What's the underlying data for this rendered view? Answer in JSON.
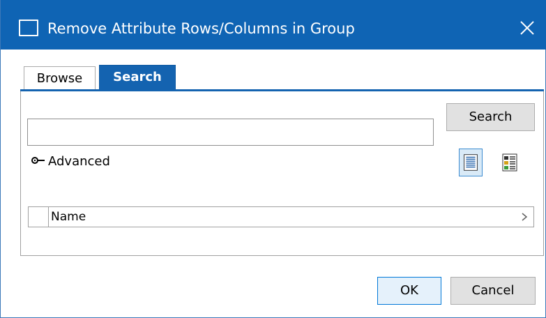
{
  "window": {
    "title": "Remove Attribute Rows/Columns in Group",
    "close_icon": "close-icon"
  },
  "tabs": [
    {
      "label": "Browse",
      "active": false
    },
    {
      "label": "Search",
      "active": true
    }
  ],
  "search": {
    "value": "",
    "button_label": "Search"
  },
  "advanced": {
    "label": "Advanced",
    "icon": "key-icon"
  },
  "view_toggles": [
    {
      "icon": "list-view-icon",
      "selected": true
    },
    {
      "icon": "detail-view-icon",
      "selected": false
    }
  ],
  "results_grid": {
    "columns": [
      "Name"
    ],
    "scroll_icon": "chevron-right-icon"
  },
  "footer": {
    "ok_label": "OK",
    "cancel_label": "Cancel"
  },
  "colors": {
    "titlebar": "#0f64b4",
    "tab_active": "#1463b0",
    "ok_border": "#0078d7"
  }
}
